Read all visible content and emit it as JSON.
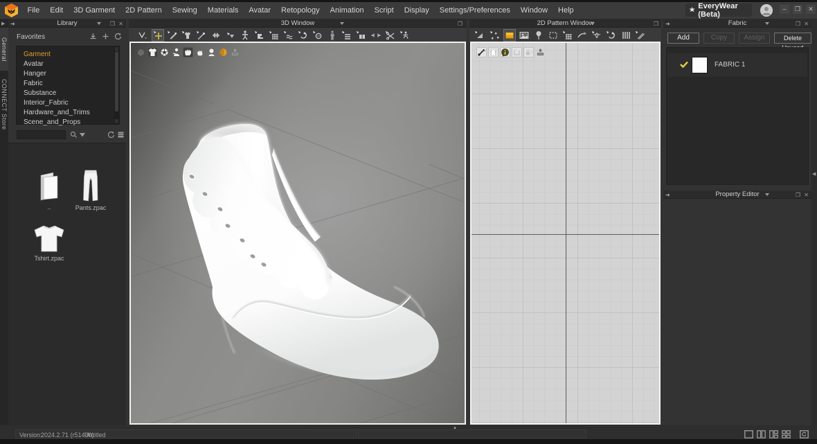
{
  "app": {
    "name": "EveryWear (Beta)",
    "version_label": "Version:",
    "version": "2024.2.71 (r51430)",
    "document": "Untitled",
    "colors": {
      "accent_orange": "#dd9f33",
      "selection_yellow": "#e3cf4a",
      "viewport2d_bg": "#d3d3d3",
      "panel_bg": "#333333",
      "menubar_bg": "#3b3b3b"
    }
  },
  "menu": {
    "items": [
      "File",
      "Edit",
      "3D Garment",
      "2D Pattern",
      "Sewing",
      "Materials",
      "Avatar",
      "Retopology",
      "Animation",
      "Script",
      "Display",
      "Settings/Preferences",
      "Window",
      "Help"
    ]
  },
  "left_dock": {
    "tabs": [
      {
        "label": "General",
        "selected": true
      },
      {
        "label": "CONNECT Store",
        "selected": false
      }
    ]
  },
  "library": {
    "title": "Library",
    "section": "Favorites",
    "items": [
      {
        "label": "Garment",
        "selected": true
      },
      {
        "label": "Avatar",
        "selected": false
      },
      {
        "label": "Hanger",
        "selected": false
      },
      {
        "label": "Fabric",
        "selected": false
      },
      {
        "label": "Substance",
        "selected": false
      },
      {
        "label": "Interior_Fabric",
        "selected": false
      },
      {
        "label": "Hardware_and_Trims",
        "selected": false
      },
      {
        "label": "Scene_and_Props",
        "selected": false
      }
    ],
    "search": {
      "value": ""
    },
    "files": [
      {
        "label": ".."
      },
      {
        "label": "Pants.zpac"
      },
      {
        "label": "Tshirt.zpac"
      }
    ]
  },
  "window3d": {
    "title": "3D Window"
  },
  "window2d": {
    "title": "2D Pattern Window"
  },
  "fabric": {
    "title": "Fabric",
    "buttons": [
      {
        "label": "Add",
        "enabled": true
      },
      {
        "label": "Copy",
        "enabled": false
      },
      {
        "label": "Assign",
        "enabled": false
      },
      {
        "label": "Delete Unused",
        "enabled": true
      }
    ],
    "items": [
      {
        "name": "FABRIC 1",
        "checked": true
      }
    ]
  },
  "property_editor": {
    "title": "Property Editor"
  },
  "statusbar": {
    "collapse_hint": "collapse"
  }
}
